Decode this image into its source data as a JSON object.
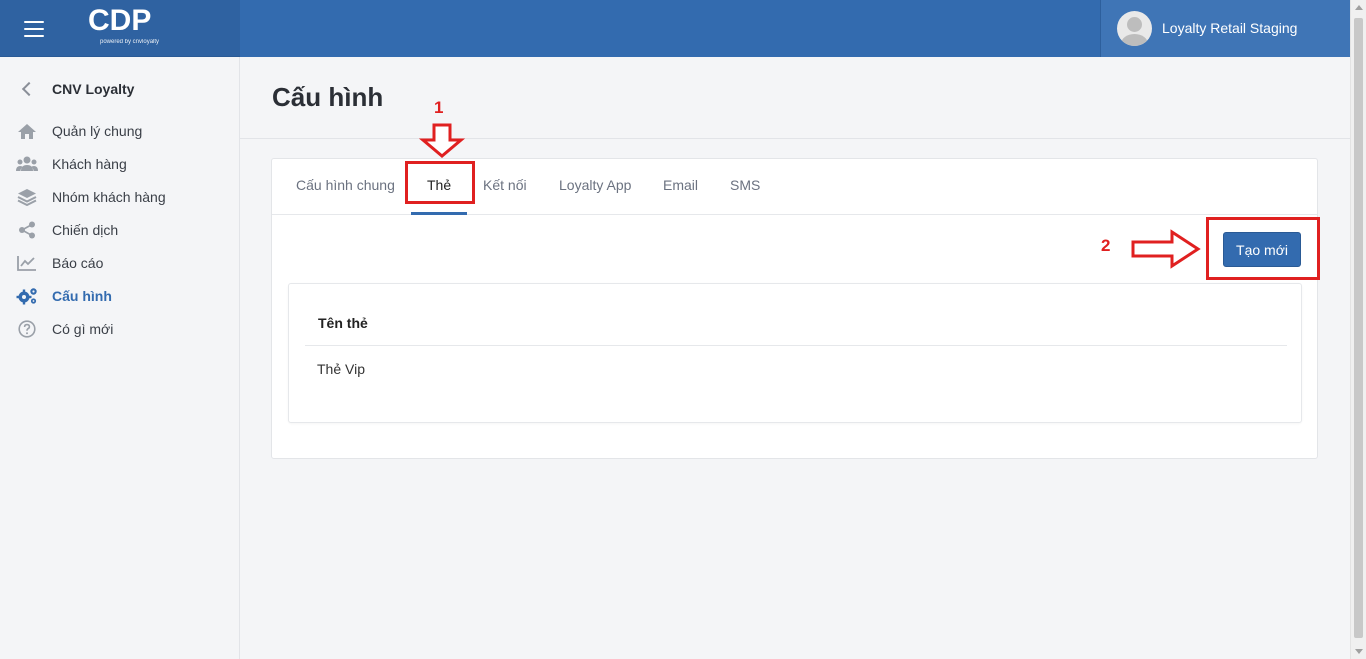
{
  "header": {
    "logo_text": "CDP",
    "logo_sub": "powered by cnvloyalty",
    "account_name": "Loyalty Retail Staging"
  },
  "sidebar": {
    "back_title": "CNV Loyalty",
    "items": [
      {
        "label": "Quản lý chung",
        "icon": "home-icon"
      },
      {
        "label": "Khách hàng",
        "icon": "users-icon"
      },
      {
        "label": "Nhóm khách hàng",
        "icon": "layers-icon"
      },
      {
        "label": "Chiến dịch",
        "icon": "share-icon"
      },
      {
        "label": "Báo cáo",
        "icon": "chart-icon"
      },
      {
        "label": "Cấu hình",
        "icon": "gears-icon",
        "active": true
      },
      {
        "label": "Có gì mới",
        "icon": "help-circle-icon"
      }
    ]
  },
  "main": {
    "page_title": "Cấu hình",
    "tabs": [
      {
        "label": "Cấu hình chung"
      },
      {
        "label": "Thẻ",
        "active": true
      },
      {
        "label": "Kết nối"
      },
      {
        "label": "Loyalty App"
      },
      {
        "label": "Email"
      },
      {
        "label": "SMS"
      }
    ],
    "create_button": "Tạo mới",
    "table": {
      "header": "Tên thẻ",
      "rows": [
        "Thẻ Vip"
      ]
    }
  },
  "annotations": {
    "step1": "1",
    "step2": "2",
    "color": "#e02020"
  },
  "colors": {
    "primary": "#336baf",
    "topbar": "#336baf",
    "background": "#f4f5f7"
  }
}
